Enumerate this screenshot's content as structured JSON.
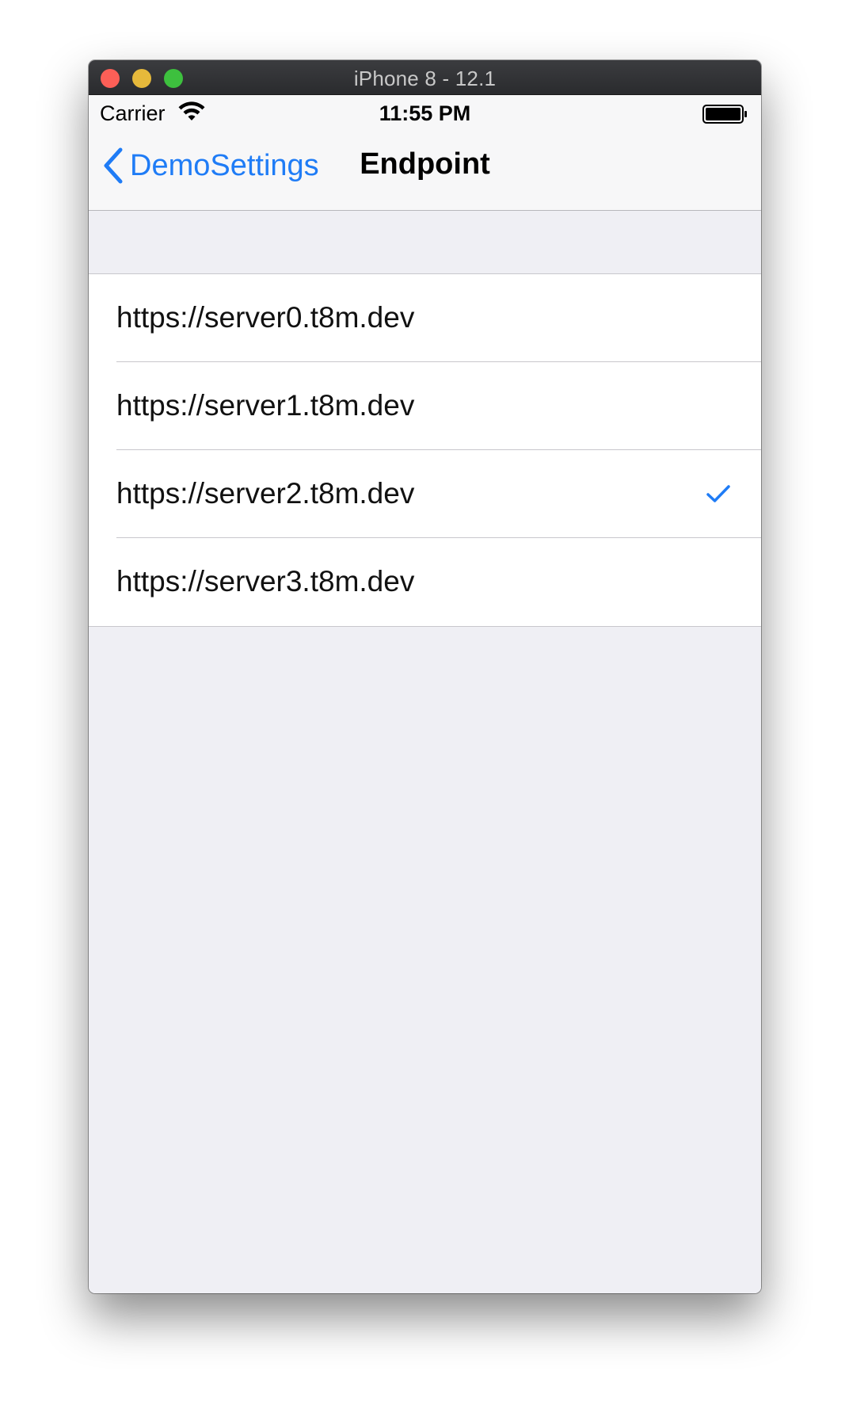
{
  "window": {
    "title": "iPhone 8 - 12.1"
  },
  "status_bar": {
    "carrier": "Carrier",
    "time": "11:55 PM",
    "wifi_icon": "wifi-icon",
    "battery_icon": "battery-full-icon"
  },
  "nav_bar": {
    "back_label": "DemoSettings",
    "back_icon": "chevron-left-icon",
    "title": "Endpoint"
  },
  "endpoints": [
    {
      "label": "https://server0.t8m.dev",
      "selected": false
    },
    {
      "label": "https://server1.t8m.dev",
      "selected": false
    },
    {
      "label": "https://server2.t8m.dev",
      "selected": true
    },
    {
      "label": "https://server3.t8m.dev",
      "selected": false
    }
  ],
  "colors": {
    "accent": "#1f7cf6",
    "background": "#efeff4",
    "titlebar": "#2a2b2e"
  }
}
